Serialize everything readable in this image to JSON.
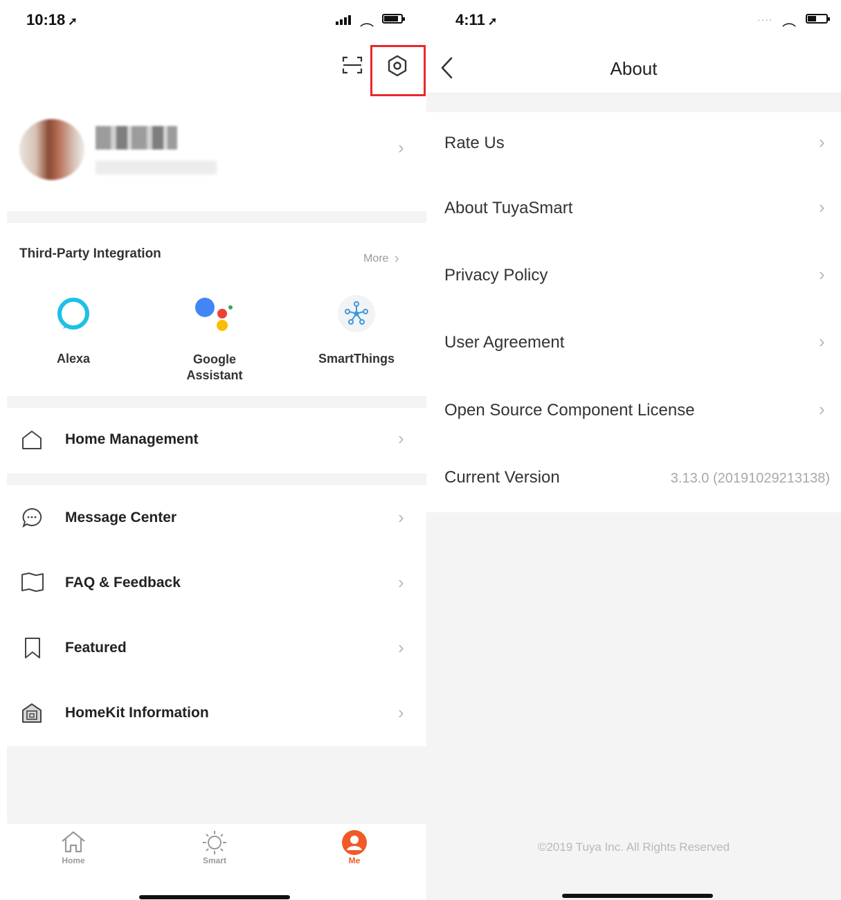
{
  "left": {
    "status": {
      "time": "10:18"
    },
    "header_icons": [
      "scan-icon",
      "settings-icon"
    ],
    "highlight_color": "#e8282b",
    "integration": {
      "title": "Third-Party Integration",
      "more": "More",
      "items": [
        {
          "label": "Alexa"
        },
        {
          "label": "Google Assistant"
        },
        {
          "label": "SmartThings"
        }
      ]
    },
    "menu": {
      "home_management": "Home Management",
      "message_center": "Message Center",
      "faq_feedback": "FAQ & Feedback",
      "featured": "Featured",
      "homekit_information": "HomeKit Information"
    },
    "tabbar": {
      "home": "Home",
      "smart": "Smart",
      "me": "Me",
      "active_color": "#f05a28"
    }
  },
  "right": {
    "status": {
      "time": "4:11"
    },
    "title": "About",
    "items": {
      "rate_us": "Rate Us",
      "about_tuyasmart": "About TuyaSmart",
      "privacy_policy": "Privacy Policy",
      "user_agreement": "User Agreement",
      "open_source": "Open Source Component License"
    },
    "version": {
      "label": "Current Version",
      "value": "3.13.0 (20191029213138)"
    },
    "footer": "©2019 Tuya Inc. All Rights Reserved"
  }
}
